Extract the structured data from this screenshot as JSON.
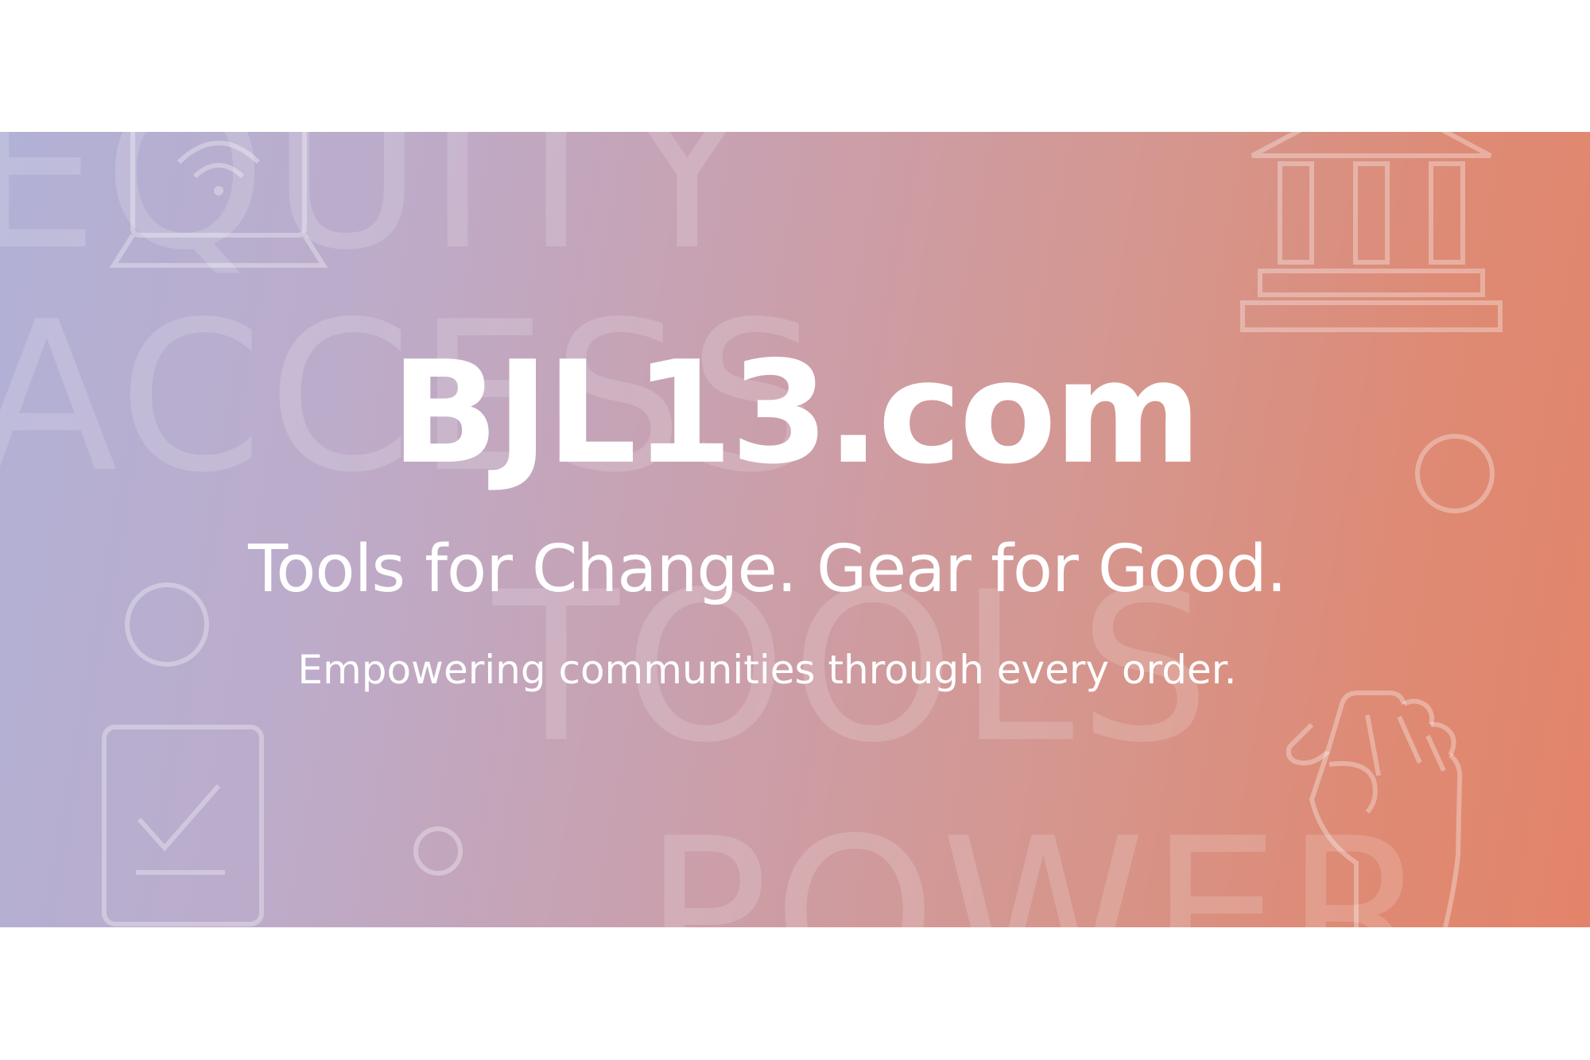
{
  "banner": {
    "title": "BJL13.com",
    "tagline": "Tools for Change. Gear for Good.",
    "subline": "Empowering communities through every order.",
    "background_words": {
      "equity": "EQUITY",
      "access": "ACCESS",
      "tools": "TOOLS",
      "power": "POWER"
    },
    "icons": [
      "laptop-wifi-icon",
      "government-building-icon",
      "checklist-icon",
      "raised-fist-icon",
      "circle-icon"
    ],
    "colors": {
      "gradient_start": "#b1b1d6",
      "gradient_end": "#e3846a",
      "text": "#ffffff"
    }
  }
}
